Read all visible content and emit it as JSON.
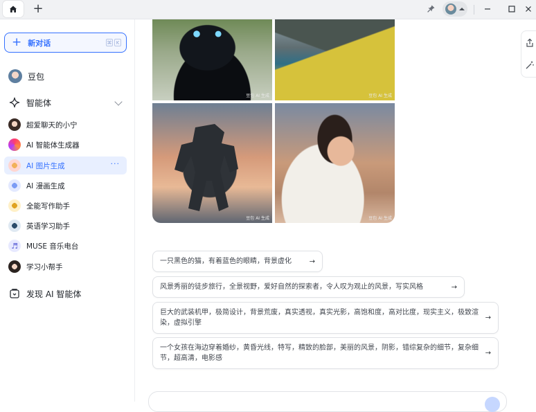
{
  "colors": {
    "accent": "#3370ff",
    "active_bg": "#e8efff",
    "text": "#1f2329"
  },
  "topbar": {
    "home_icon": "home-icon",
    "new_tab_label": "+",
    "window": {
      "minimize": "—",
      "restore": "☐",
      "close": "✕"
    }
  },
  "sidebar": {
    "new_chat_label": "新对话",
    "shortcut_keys": [
      "⌘",
      "K"
    ],
    "doubao_label": "豆包",
    "agents_label": "智能体",
    "items": [
      {
        "label": "超爱聊天的小宁",
        "icon": "avatar-girl-icon"
      },
      {
        "label": "AI 智能体生成器",
        "icon": "gradient-orb-icon"
      },
      {
        "label": "AI 图片生成",
        "icon": "palette-icon",
        "active": true,
        "more": "···"
      },
      {
        "label": "AI 漫画生成",
        "icon": "comic-icon"
      },
      {
        "label": "全能写作助手",
        "icon": "pen-icon"
      },
      {
        "label": "英语学习助手",
        "icon": "globe-icon"
      },
      {
        "label": "MUSE 音乐电台",
        "icon": "music-icon"
      },
      {
        "label": "学习小帮手",
        "icon": "student-avatar-icon"
      }
    ],
    "discover_label": "发现 AI 智能体"
  },
  "main": {
    "images": [
      {
        "name": "black-cat-image",
        "watermark": "豆包 AI 生成"
      },
      {
        "name": "fjord-landscape-image",
        "watermark": "豆包 AI 生成"
      },
      {
        "name": "mech-robot-image",
        "watermark": "豆包 AI 生成"
      },
      {
        "name": "bride-portrait-image",
        "watermark": "豆包 AI 生成"
      }
    ],
    "suggestions": [
      "一只黑色的猫，有着蓝色的眼睛，背景虚化",
      "风景秀丽的徒步旅行，全景视野，爱好自然的探索者，令人叹为观止的风景，写实风格",
      "巨大的武装机甲，极简设计，背景荒废，真实透视，真实光影，高饱和度，高对比度，现实主义，极致渲染，虚拟引擎",
      "一个女孩在海边穿着婚纱，黄昏光线，特写，精致的脸部，美丽的风景，阴影，错综复杂的细节，复杂细节，超高清，电影感"
    ],
    "arrow": "→"
  }
}
